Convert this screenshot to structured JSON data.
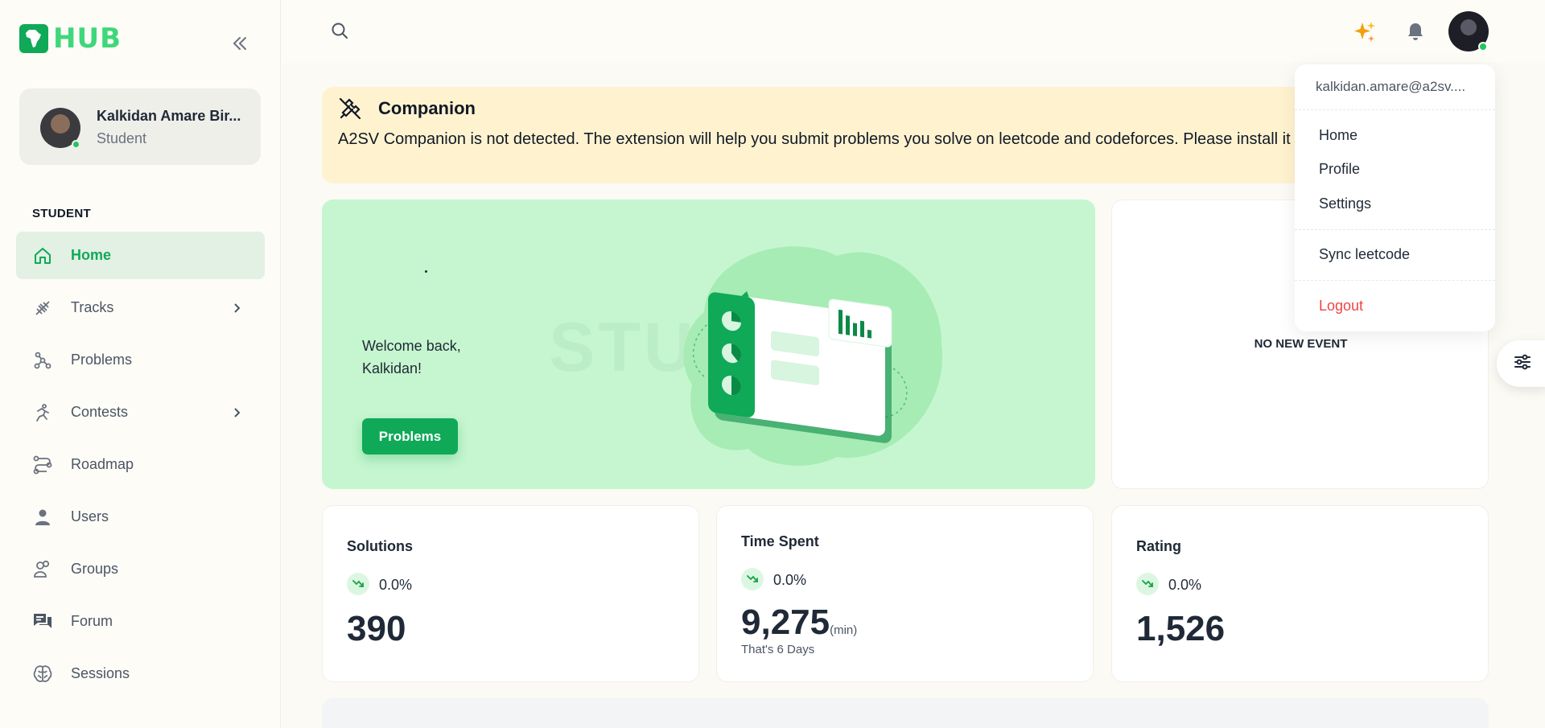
{
  "app": {
    "logo_text": "HUB"
  },
  "user": {
    "name": "Kalkidan Amare Bir...",
    "role": "Student",
    "email": "kalkidan.amare@a2sv...."
  },
  "sidebar": {
    "section_label": "STUDENT",
    "items": [
      {
        "label": "Home",
        "icon": "home-icon",
        "active": true
      },
      {
        "label": "Tracks",
        "icon": "tracks-icon",
        "has_chevron": true
      },
      {
        "label": "Problems",
        "icon": "problems-icon"
      },
      {
        "label": "Contests",
        "icon": "contests-icon",
        "has_chevron": true
      },
      {
        "label": "Roadmap",
        "icon": "roadmap-icon"
      },
      {
        "label": "Users",
        "icon": "users-icon"
      },
      {
        "label": "Groups",
        "icon": "groups-icon"
      },
      {
        "label": "Forum",
        "icon": "forum-icon"
      },
      {
        "label": "Sessions",
        "icon": "sessions-icon"
      }
    ]
  },
  "alert": {
    "title": "Companion",
    "message": "A2SV Companion is not detected. The extension will help you submit problems you solve on leetcode and codeforces. Please install it and reload this page."
  },
  "hero": {
    "welcome": "Welcome back, Kalkidan!",
    "button_label": "Problems",
    "watermark": "STUDENT"
  },
  "events": {
    "empty_text": "NO NEW EVENT"
  },
  "stats": {
    "solutions": {
      "title": "Solutions",
      "trend": "0.0%",
      "value": "390"
    },
    "time_spent": {
      "title": "Time Spent",
      "trend": "0.0%",
      "value": "9,275",
      "unit": "(min)",
      "sub": "That's 6 Days"
    },
    "rating": {
      "title": "Rating",
      "trend": "0.0%",
      "value": "1,526"
    }
  },
  "dropdown": {
    "items": [
      "Home",
      "Profile",
      "Settings"
    ],
    "sync_label": "Sync leetcode",
    "logout_label": "Logout"
  },
  "colors": {
    "brand": "#0fa958",
    "active_bg": "#e3f0e4",
    "alert_bg": "#fff3cf",
    "hero_bg": "#c6f6cf",
    "logout": "#ef4444"
  }
}
